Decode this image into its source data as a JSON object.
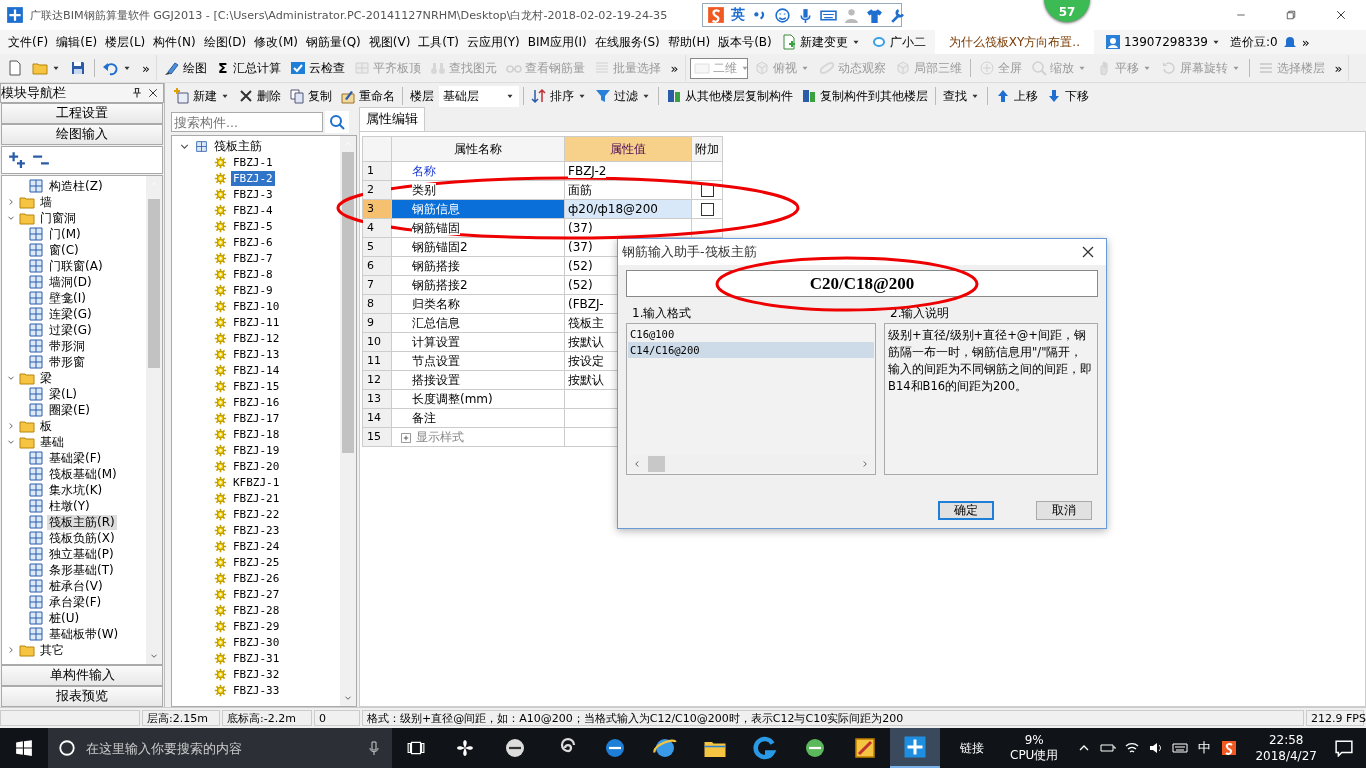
{
  "window": {
    "title": "广联达BIM钢筋算量软件 GGJ2013 - [C:\\Users\\Administrator.PC-20141127NRHM\\Desktop\\白龙村-2018-02-02-19-24-35"
  },
  "ime_bar": {
    "mode": "英"
  },
  "badge": {
    "count": "57"
  },
  "menu": {
    "items": [
      "文件(F)",
      "编辑(E)",
      "楼层(L)",
      "构件(N)",
      "绘图(D)",
      "修改(M)",
      "钢筋量(Q)",
      "视图(V)",
      "工具(T)",
      "云应用(Y)",
      "BIM应用(I)",
      "在线服务(S)",
      "帮助(H)",
      "版本号(B)"
    ],
    "change": {
      "label": "新建变更",
      "dropdown": true
    },
    "assistant": {
      "label": "广小二"
    },
    "news": "为什么筏板XY方向布置..",
    "account": {
      "label": "13907298339",
      "dropdown": true
    },
    "beans": "造价豆:0",
    "overflow": "»"
  },
  "toolbar_bands": [
    {
      "items": [
        {
          "kind": "icon",
          "disabled": false,
          "dropdown": false
        },
        {
          "kind": "icon",
          "disabled": false,
          "dropdown": true
        },
        {
          "kind": "icon",
          "disabled": false,
          "dropdown": false
        },
        {
          "kind": "separator"
        },
        {
          "kind": "icon",
          "disabled": false,
          "dropdown": true
        }
      ],
      "overflow": "»"
    },
    {
      "items": [
        {
          "kind": "button",
          "label": "绘图",
          "disabled": false,
          "dropdown": false
        },
        {
          "kind": "glyph",
          "glyph": "Σ",
          "label": "汇总计算",
          "disabled": false,
          "dropdown": false
        },
        {
          "kind": "button",
          "label": "云检查",
          "disabled": false,
          "dropdown": false
        },
        {
          "kind": "button",
          "label": "平齐板顶",
          "disabled": true,
          "dropdown": false
        },
        {
          "kind": "button",
          "label": "查找图元",
          "disabled": true,
          "dropdown": false
        },
        {
          "kind": "button",
          "label": "查看钢筋量",
          "disabled": true,
          "dropdown": false
        },
        {
          "kind": "button",
          "label": "批量选择",
          "disabled": true,
          "dropdown": false
        }
      ],
      "overflow": "»"
    },
    {
      "items": [
        {
          "kind": "combo",
          "label": "二维",
          "disabled": true,
          "dropdown": true
        },
        {
          "kind": "button",
          "label": "俯视",
          "disabled": true,
          "dropdown": true
        },
        {
          "kind": "button",
          "label": "动态观察",
          "disabled": true,
          "dropdown": false
        },
        {
          "kind": "button",
          "label": "局部三维",
          "disabled": true,
          "dropdown": false
        },
        {
          "kind": "separator"
        },
        {
          "kind": "button",
          "label": "全屏",
          "disabled": true,
          "dropdown": false
        },
        {
          "kind": "button",
          "label": "缩放",
          "disabled": true,
          "dropdown": true
        },
        {
          "kind": "button",
          "label": "平移",
          "disabled": true,
          "dropdown": true
        },
        {
          "kind": "button",
          "label": "屏幕旋转",
          "disabled": true,
          "dropdown": true
        },
        {
          "kind": "separator"
        },
        {
          "kind": "button",
          "label": "选择楼层",
          "disabled": true,
          "dropdown": false
        }
      ],
      "overflow": "»"
    }
  ],
  "component_toolbar": [
    {
      "kind": "button",
      "label": "新建",
      "dropdown": true
    },
    {
      "kind": "button",
      "label": "删除",
      "dropdown": false
    },
    {
      "kind": "button",
      "label": "复制",
      "dropdown": false
    },
    {
      "kind": "button",
      "label": "重命名",
      "dropdown": false
    },
    {
      "kind": "separator"
    },
    {
      "kind": "label",
      "label": "楼层"
    },
    {
      "kind": "combo",
      "label": "基础层",
      "dropdown": true
    },
    {
      "kind": "separator"
    },
    {
      "kind": "button",
      "label": "排序",
      "dropdown": true
    },
    {
      "kind": "button",
      "label": "过滤",
      "dropdown": true
    },
    {
      "kind": "separator"
    },
    {
      "kind": "button",
      "label": "从其他楼层复制构件",
      "dropdown": false
    },
    {
      "kind": "button",
      "label": "复制构件到其他楼层",
      "dropdown": false
    },
    {
      "kind": "separator"
    },
    {
      "kind": "text_button",
      "label": "查找",
      "dropdown": true
    },
    {
      "kind": "separator"
    },
    {
      "kind": "button",
      "label": "上移",
      "dropdown": false
    },
    {
      "kind": "button",
      "label": "下移",
      "dropdown": false
    }
  ],
  "nav": {
    "title": "模块导航栏",
    "sections": [
      "工程设置",
      "绘图输入"
    ],
    "tree_top": [
      {
        "label": "构造柱(Z)",
        "selected": false
      }
    ],
    "tree": [
      {
        "label": "墙",
        "expanded": false
      },
      {
        "label": "门窗洞",
        "expanded": true,
        "children": [
          {
            "label": "门(M)",
            "selected": false
          },
          {
            "label": "窗(C)",
            "selected": false
          },
          {
            "label": "门联窗(A)",
            "selected": false
          },
          {
            "label": "墙洞(D)",
            "selected": false
          },
          {
            "label": "壁龛(I)",
            "selected": false
          },
          {
            "label": "连梁(G)",
            "selected": false
          },
          {
            "label": "过梁(G)",
            "selected": false
          },
          {
            "label": "带形洞",
            "selected": false
          },
          {
            "label": "带形窗",
            "selected": false
          }
        ]
      },
      {
        "label": "梁",
        "expanded": true,
        "children": [
          {
            "label": "梁(L)",
            "selected": false
          },
          {
            "label": "圈梁(E)",
            "selected": false
          }
        ]
      },
      {
        "label": "板",
        "expanded": false
      },
      {
        "label": "基础",
        "expanded": true,
        "children": [
          {
            "label": "基础梁(F)",
            "selected": false
          },
          {
            "label": "筏板基础(M)",
            "selected": false
          },
          {
            "label": "集水坑(K)",
            "selected": false
          },
          {
            "label": "柱墩(Y)",
            "selected": false
          },
          {
            "label": "筏板主筋(R)",
            "selected": true
          },
          {
            "label": "筏板负筋(X)",
            "selected": false
          },
          {
            "label": "独立基础(P)",
            "selected": false
          },
          {
            "label": "条形基础(T)",
            "selected": false
          },
          {
            "label": "桩承台(V)",
            "selected": false
          },
          {
            "label": "承台梁(F)",
            "selected": false
          },
          {
            "label": "桩(U)",
            "selected": false
          },
          {
            "label": "基础板带(W)",
            "selected": false
          }
        ]
      },
      {
        "label": "其它",
        "expanded": false
      }
    ],
    "bottom_sections": [
      "单构件输入",
      "报表预览"
    ]
  },
  "components": {
    "search": {
      "placeholder": "搜索构件..."
    },
    "root": {
      "label": "筏板主筋",
      "expanded": true,
      "children": [
        {
          "label": "FBZJ-1",
          "selected": false
        },
        {
          "label": "FBZJ-2",
          "selected": true
        },
        {
          "label": "FBZJ-3",
          "selected": false
        },
        {
          "label": "FBZJ-4",
          "selected": false
        },
        {
          "label": "FBZJ-5",
          "selected": false
        },
        {
          "label": "FBZJ-6",
          "selected": false
        },
        {
          "label": "FBZJ-7",
          "selected": false
        },
        {
          "label": "FBZJ-8",
          "selected": false
        },
        {
          "label": "FBZJ-9",
          "selected": false
        },
        {
          "label": "FBZJ-10",
          "selected": false
        },
        {
          "label": "FBZJ-11",
          "selected": false
        },
        {
          "label": "FBZJ-12",
          "selected": false
        },
        {
          "label": "FBZJ-13",
          "selected": false
        },
        {
          "label": "FBZJ-14",
          "selected": false
        },
        {
          "label": "FBZJ-15",
          "selected": false
        },
        {
          "label": "FBZJ-16",
          "selected": false
        },
        {
          "label": "FBZJ-17",
          "selected": false
        },
        {
          "label": "FBZJ-18",
          "selected": false
        },
        {
          "label": "FBZJ-19",
          "selected": false
        },
        {
          "label": "FBZJ-20",
          "selected": false
        },
        {
          "label": "KFBZJ-1",
          "selected": false
        },
        {
          "label": "FBZJ-21",
          "selected": false
        },
        {
          "label": "FBZJ-22",
          "selected": false
        },
        {
          "label": "FBZJ-23",
          "selected": false
        },
        {
          "label": "FBZJ-24",
          "selected": false
        },
        {
          "label": "FBZJ-25",
          "selected": false
        },
        {
          "label": "FBZJ-26",
          "selected": false
        },
        {
          "label": "FBZJ-27",
          "selected": false
        },
        {
          "label": "FBZJ-28",
          "selected": false
        },
        {
          "label": "FBZJ-29",
          "selected": false
        },
        {
          "label": "FBZJ-30",
          "selected": false
        },
        {
          "label": "FBZJ-31",
          "selected": false
        },
        {
          "label": "FBZJ-32",
          "selected": false
        },
        {
          "label": "FBZJ-33",
          "selected": false
        }
      ]
    }
  },
  "properties": {
    "tab": "属性编辑",
    "circled": true,
    "columns": [
      {
        "label": "属性名称",
        "highlighted": false
      },
      {
        "label": "属性值",
        "highlighted": true
      },
      {
        "label": "附加",
        "highlighted": false
      }
    ],
    "rows": [
      {
        "number": "1",
        "name": "名称",
        "value": "FBZJ-2",
        "kind": "primary",
        "selected": false
      },
      {
        "number": "2",
        "name": "类别",
        "value": "面筋",
        "kind": "plain",
        "selected": false,
        "attachment": {
          "checked": false
        }
      },
      {
        "number": "3",
        "name": "钢筋信息",
        "value": "ф20/ф18@200",
        "kind": "plain",
        "selected": true,
        "attachment": {
          "checked": false
        }
      },
      {
        "number": "4",
        "name": "钢筋锚固",
        "value": "(37)",
        "kind": "plain",
        "selected": false
      },
      {
        "number": "5",
        "name": "钢筋锚固2",
        "value": "(37)",
        "kind": "plain",
        "selected": false
      },
      {
        "number": "6",
        "name": "钢筋搭接",
        "value": "(52)",
        "kind": "plain",
        "selected": false
      },
      {
        "number": "7",
        "name": "钢筋搭接2",
        "value": "(52)",
        "kind": "plain",
        "selected": false
      },
      {
        "number": "8",
        "name": "归类名称",
        "value": "(FBZJ-",
        "kind": "plain",
        "selected": false
      },
      {
        "number": "9",
        "name": "汇总信息",
        "value": "筏板主",
        "kind": "plain",
        "selected": false
      },
      {
        "number": "10",
        "name": "计算设置",
        "value": "按默认",
        "kind": "plain",
        "selected": false
      },
      {
        "number": "11",
        "name": "节点设置",
        "value": "按设定",
        "kind": "plain",
        "selected": false
      },
      {
        "number": "12",
        "name": "搭接设置",
        "value": "按默认",
        "kind": "plain",
        "selected": false
      },
      {
        "number": "13",
        "name": "长度调整(mm)",
        "kind": "plain",
        "selected": false
      },
      {
        "number": "14",
        "name": "备注",
        "kind": "plain",
        "selected": false
      },
      {
        "number": "15",
        "name": "显示样式",
        "kind": "group",
        "expanded": false,
        "selected": false
      }
    ]
  },
  "dialog": {
    "title": "钢筋输入助手-筏板主筋",
    "input": {
      "value": "C20/C18@200",
      "circled": true
    },
    "format_label": "1.输入格式",
    "formats": [
      {
        "label": "C16@100",
        "selected": false
      },
      {
        "label": "C14/C16@200",
        "selected": true
      }
    ],
    "help_label": "2.输入说明",
    "help": "级别+直径/级别+直径+@+间距，钢筋隔一布一时，钢筋信息用\"/\"隔开，输入的间距为不同钢筋之间的间距，即B14和B16的间距为200。",
    "buttons": [
      {
        "label": "确定",
        "default": true
      },
      {
        "label": "取消",
        "default": false
      }
    ]
  },
  "status_bar": {
    "cells": [
      "层高:2.15m",
      "底标高:-2.2m",
      "0",
      "格式：级别+直径@间距，如：A10@200；当格式输入为C12/C10@200时，表示C12与C10实际间距为200",
      "212.9 FPS"
    ]
  },
  "taskbar": {
    "search": {
      "placeholder": "在这里输入你要搜索的内容"
    },
    "apps": [
      {
        "active": false
      },
      {
        "active": false
      },
      {
        "active": false
      },
      {
        "active": false
      },
      {
        "active": false
      },
      {
        "active": false
      },
      {
        "active": false
      },
      {
        "active": false
      },
      {
        "active": false
      },
      {
        "active": true
      }
    ],
    "links": "链接",
    "cpu": {
      "value": "9%",
      "label": "CPU使用"
    },
    "ime": "中",
    "time": "22:58",
    "date": "2018/4/27"
  }
}
